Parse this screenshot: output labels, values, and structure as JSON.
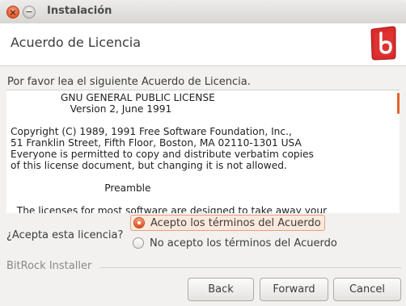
{
  "window": {
    "title": "Instalación",
    "close_glyph": "×",
    "minimize_glyph": "−"
  },
  "header": {
    "title": "Acuerdo de Licencia",
    "logo_icon": "bitrock-logo-icon"
  },
  "prompt": "Por favor lea el siguiente Acuerdo de Licencia.",
  "license": {
    "text": "                GNU GENERAL PUBLIC LICENSE\n                   Version 2, June 1991\n\nCopyright (C) 1989, 1991 Free Software Foundation, Inc.,\n51 Franklin Street, Fifth Floor, Boston, MA 02110-1301 USA\nEveryone is permitted to copy and distribute verbatim copies\nof this license document, but changing it is not allowed.\n\n                              Preamble\n\n  The licenses for most software are designed to take away your"
  },
  "question": {
    "label": "¿Acepta esta licencia?",
    "options": [
      {
        "label": "Acepto los términos del Acuerdo",
        "selected": true
      },
      {
        "label": "No acepto los términos del Acuerdo",
        "selected": false
      }
    ]
  },
  "footer": {
    "brand": "BitRock Installer",
    "back_label": "Back",
    "forward_label": "Forward",
    "cancel_label": "Cancel"
  },
  "colors": {
    "accent": "#dd4d1f",
    "logo_red": "#d92b2b"
  }
}
